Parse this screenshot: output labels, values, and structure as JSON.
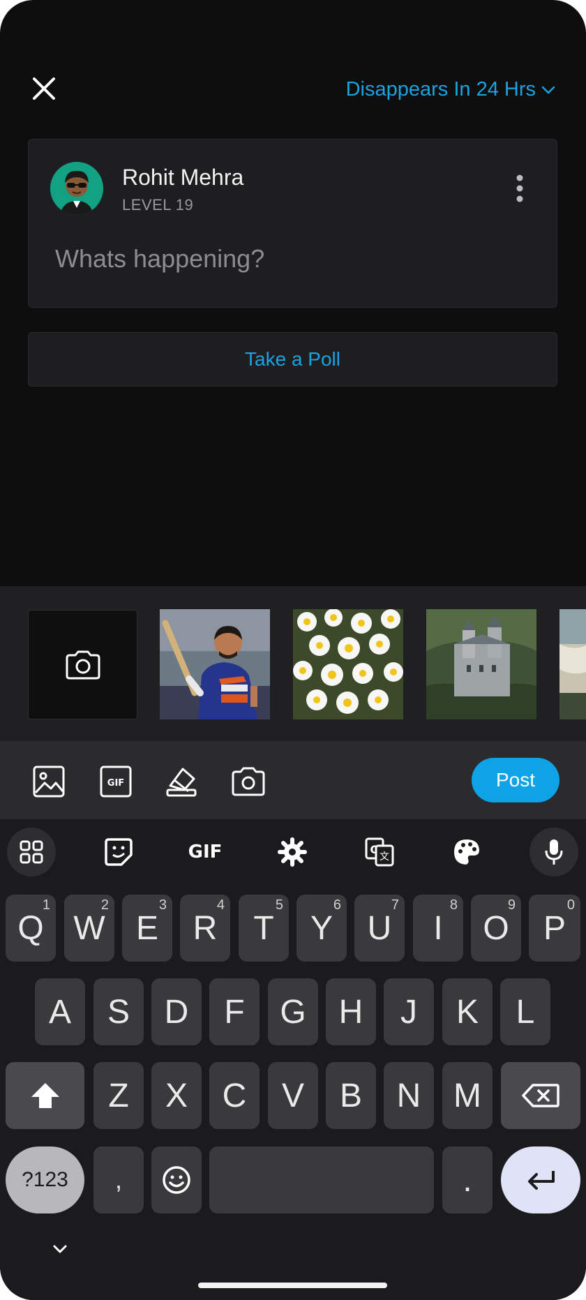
{
  "header": {
    "expiry_label": "Disappears In 24 Hrs"
  },
  "composer": {
    "user_name": "Rohit Mehra",
    "user_level": "LEVEL 19",
    "placeholder": "Whats happening?"
  },
  "poll": {
    "label": "Take a Poll"
  },
  "media_strip": {
    "thumbnails": [
      "cricket-player-photo",
      "white-flowers-photo",
      "castle-photo",
      "beach-photo"
    ]
  },
  "toolbar": {
    "icons": [
      "image-icon",
      "gif-icon",
      "eraser-icon",
      "camera-icon"
    ],
    "post_label": "Post"
  },
  "keyboard": {
    "toolbar": {
      "gif_label": "GIF"
    },
    "row1": [
      {
        "key": "Q",
        "hint": "1"
      },
      {
        "key": "W",
        "hint": "2"
      },
      {
        "key": "E",
        "hint": "3"
      },
      {
        "key": "R",
        "hint": "4"
      },
      {
        "key": "T",
        "hint": "5"
      },
      {
        "key": "Y",
        "hint": "6"
      },
      {
        "key": "U",
        "hint": "7"
      },
      {
        "key": "I",
        "hint": "8"
      },
      {
        "key": "O",
        "hint": "9"
      },
      {
        "key": "P",
        "hint": "0"
      }
    ],
    "row2": [
      "A",
      "S",
      "D",
      "F",
      "G",
      "H",
      "J",
      "K",
      "L"
    ],
    "row3": [
      "Z",
      "X",
      "C",
      "V",
      "B",
      "N",
      "M"
    ],
    "row4": {
      "symbols": "?123",
      "comma": ",",
      "period": "."
    }
  },
  "colors": {
    "accent": "#1aa3e0",
    "post_button": "#0ea3e6",
    "background": "#0e0e0f",
    "card": "#1e1e20"
  }
}
